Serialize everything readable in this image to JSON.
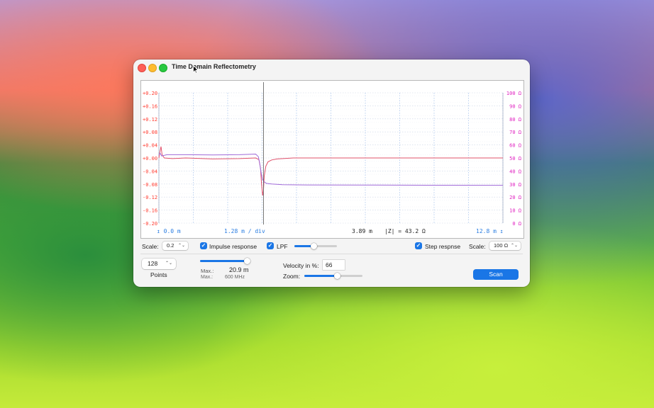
{
  "window": {
    "title": "Time Domain Reflectometry"
  },
  "chart_data": {
    "type": "line",
    "left_axis": {
      "ticks": [
        "+0.20",
        "+0.16",
        "+0.12",
        "+0.08",
        "+0.04",
        "+0.00",
        "-0.04",
        "-0.08",
        "-0.12",
        "-0.16",
        "-0.20"
      ],
      "range": [
        -0.2,
        0.2
      ],
      "color": "#ff3b30"
    },
    "right_axis": {
      "ticks": [
        "100 Ω",
        "90 Ω",
        "80 Ω",
        "70 Ω",
        "60 Ω",
        "50 Ω",
        "40 Ω",
        "30 Ω",
        "20 Ω",
        "10 Ω",
        "0 Ω"
      ],
      "range": [
        0,
        100
      ],
      "color": "#e020c0"
    },
    "x_range_m": [
      0,
      12.8
    ],
    "grid": true,
    "cursor_x_m": 3.89,
    "series": [
      {
        "color": "#e0506a",
        "x": [
          0,
          0.03,
          0.08,
          0.12,
          0.2,
          0.5,
          1.0,
          2.0,
          3.0,
          3.6,
          3.72,
          3.78,
          3.82,
          3.86,
          3.89,
          3.92,
          3.98,
          4.06,
          4.2,
          4.4,
          5.0,
          6.0,
          8.0,
          10.0,
          12.8
        ],
        "y": [
          0.0,
          0.015,
          0.035,
          0.01,
          0.0,
          -0.002,
          0.0,
          -0.003,
          -0.002,
          0.0,
          -0.005,
          -0.03,
          -0.08,
          -0.115,
          -0.1,
          -0.055,
          -0.025,
          -0.012,
          -0.006,
          -0.003,
          0.0,
          0.0,
          0.0,
          0.0,
          0.0
        ]
      },
      {
        "color": "#a06ad8",
        "x": [
          0,
          0.05,
          0.1,
          0.3,
          1.0,
          2.0,
          3.0,
          3.6,
          3.7,
          3.75,
          3.8,
          3.85,
          3.9,
          4.0,
          4.2,
          4.6,
          5.5,
          8.0,
          10.0,
          12.8
        ],
        "y_ohm": [
          52.5,
          53.5,
          51.5,
          52.5,
          52.5,
          52.3,
          52.5,
          53,
          51,
          46,
          39,
          34,
          32,
          30.5,
          30,
          29.5,
          29.3,
          29.2,
          29.1,
          29.0
        ]
      }
    ]
  },
  "status_bar": {
    "start_value": "0.0 m",
    "scale_value": "1.28 m / div",
    "position_value": "3.89 m",
    "impedance_value": "|Z| = 43.2 Ω",
    "end_value": "12.8 m"
  },
  "controls": {
    "scale_label": "Scale:",
    "scale_value": "0.2",
    "impulse_label": "Impulse response",
    "impulse_checked": true,
    "lpf_label": "LPF",
    "lpf_checked": true,
    "lpf_level": 0.45,
    "step_label": "Step respnse",
    "step_checked": true,
    "scale2_label": "Scale:",
    "scale2_value": "100 Ω",
    "points_value": "128",
    "points_label": "Points",
    "max_slider_level": 0.95,
    "max_label": "Max.:",
    "max_distance": "20.9 m",
    "max_label2": "Max.:",
    "max_freq": "600 MHz",
    "velocity_label": "Velocity in %:",
    "velocity_value": "66",
    "zoom_label": "Zoom:",
    "zoom_level": 0.57,
    "scan_label": "Scan"
  }
}
